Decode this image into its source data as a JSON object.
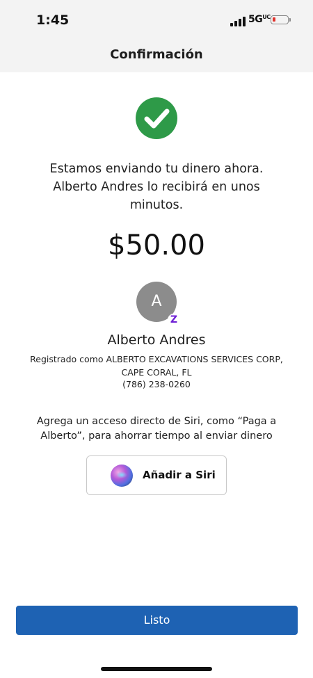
{
  "status_bar": {
    "time": "1:45",
    "network": "5G",
    "network_uc": "UC",
    "battery_level": "low"
  },
  "header": {
    "title": "Confirmación"
  },
  "confirmation": {
    "status_icon": "checkmark-circle-icon",
    "message": "Estamos enviando tu dinero ahora. Alberto Andres lo recibirá en unos minutos.",
    "amount": "$50.00"
  },
  "recipient": {
    "initial": "A",
    "badge": "zelle-logo-icon",
    "name": "Alberto Andres",
    "registered_as": "Registrado como ALBERTO EXCAVATIONS SERVICES CORP, CAPE CORAL, FL",
    "phone": "(786) 238-0260"
  },
  "siri": {
    "hint": "Agrega un acceso directo de Siri, como “Paga a Alberto”, para ahorrar tiempo al enviar dinero",
    "button_label": "Añadir a Siri",
    "icon": "siri-icon"
  },
  "footer": {
    "done_label": "Listo"
  },
  "colors": {
    "success": "#2e9a48",
    "primary": "#1e62b3",
    "zelle": "#6d1ed4"
  }
}
